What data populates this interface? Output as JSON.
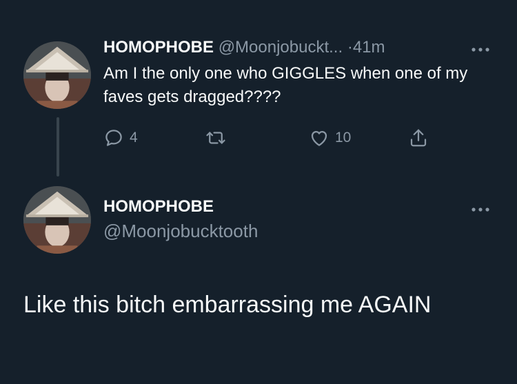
{
  "reply_tweet": {
    "display_name": "HOMOPHOBE",
    "handle": "@Moonjobuckt...",
    "separator": "·",
    "time": "41m",
    "more_icon": "more-horizontal-icon",
    "text": "Am I the only one who GIGGLES when one of my faves gets dragged????",
    "actions": {
      "reply_count": "4",
      "retweet_count": "",
      "like_count": "10"
    }
  },
  "main_tweet": {
    "display_name": "HOMOPHOBE",
    "handle": "@Moonjobucktooth",
    "more_icon": "more-horizontal-icon",
    "text": "Like this bitch embarrassing me AGAIN"
  },
  "colors": {
    "background": "#15202b",
    "text": "#f7f9f9",
    "muted": "#8b98a5",
    "thread_line": "#38444d"
  }
}
